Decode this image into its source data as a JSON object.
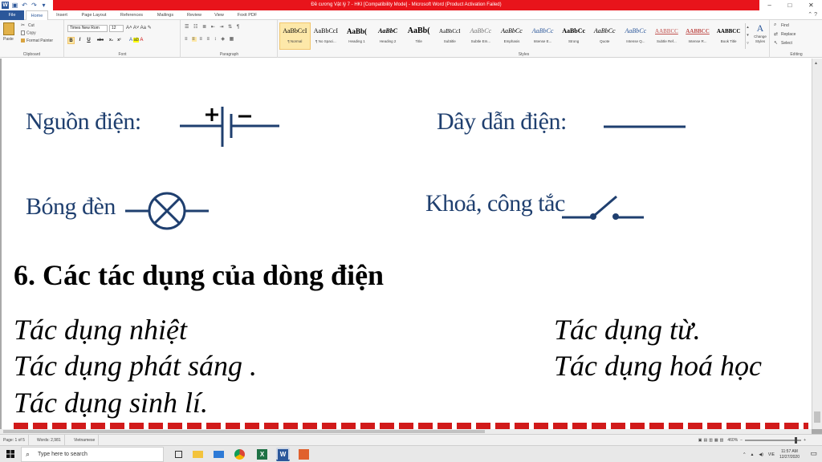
{
  "titlebar": {
    "title": "Đề cương Vật lý 7 - HKI [Compatibility Mode] - Microsoft Word (Product Activation Failed)",
    "window_controls": [
      "–",
      "□",
      "✕"
    ]
  },
  "tabs": [
    "File",
    "Home",
    "Insert",
    "Page Layout",
    "References",
    "Mailings",
    "Review",
    "View",
    "Foxit PDF"
  ],
  "active_tab": "Home",
  "ribbon": {
    "clipboard": {
      "paste": "Paste",
      "cut": "Cut",
      "copy": "Copy",
      "format_painter": "Format Painter",
      "label": "Clipboard"
    },
    "font": {
      "name": "Times New Rom",
      "size": "12",
      "bold": "B",
      "italic": "I",
      "underline": "U",
      "strike": "abc",
      "sub": "x₂",
      "sup": "x²",
      "label": "Font"
    },
    "paragraph": {
      "label": "Paragraph"
    },
    "styles": {
      "label": "Styles",
      "items": [
        {
          "sample": "AaBbCcI",
          "name": "¶ Normal"
        },
        {
          "sample": "AaBbCcI",
          "name": "¶ No Spaci..."
        },
        {
          "sample": "AaBb(",
          "name": "Heading 1"
        },
        {
          "sample": "AaBbC",
          "name": "Heading 2"
        },
        {
          "sample": "AaBb(",
          "name": "Title"
        },
        {
          "sample": "AaBbCcI",
          "name": "Subtitle"
        },
        {
          "sample": "AaBbCc",
          "name": "Subtle Em..."
        },
        {
          "sample": "AaBbCc",
          "name": "Emphasis"
        },
        {
          "sample": "AaBbCc",
          "name": "Intense E..."
        },
        {
          "sample": "AaBbCc",
          "name": "Strong"
        },
        {
          "sample": "AaBbCc",
          "name": "Quote"
        },
        {
          "sample": "AaBbCc",
          "name": "Intense Q..."
        },
        {
          "sample": "AABBCC",
          "name": "Subtle Ref..."
        },
        {
          "sample": "AABBCC",
          "name": "Intense R..."
        },
        {
          "sample": "AABBCC",
          "name": "Book Title"
        }
      ],
      "change_styles": "Change Styles"
    },
    "editing": {
      "find": "Find",
      "replace": "Replace",
      "select": "Select",
      "label": "Editing"
    }
  },
  "document": {
    "symbols": {
      "power_source": "Nguồn điện:",
      "wire": "Dây dẫn điện:",
      "bulb": "Bóng đèn",
      "switch": "Khoá, công tắc"
    },
    "heading": "6. Các tác dụng của dòng điện",
    "effects": {
      "heat": "Tác dụng nhiệt",
      "magnetic": "Tác dụng từ.",
      "light": "Tác dụng phát sáng .",
      "chemical": "Tác dụng hoá học",
      "physiological": "Tác dụng sinh lí."
    }
  },
  "statusbar": {
    "page": "Page: 1 of 5",
    "words": "Words: 2,981",
    "language": "Vietnamese",
    "zoom": "460%"
  },
  "taskbar": {
    "search_placeholder": "Type here to search",
    "tray_lang": "VIE",
    "time": "11:57 AM",
    "date": "12/27/2020"
  },
  "colors": {
    "title_red": "#e8141b",
    "word_blue": "#2b579a",
    "symbol_blue": "#1f3f6f"
  }
}
